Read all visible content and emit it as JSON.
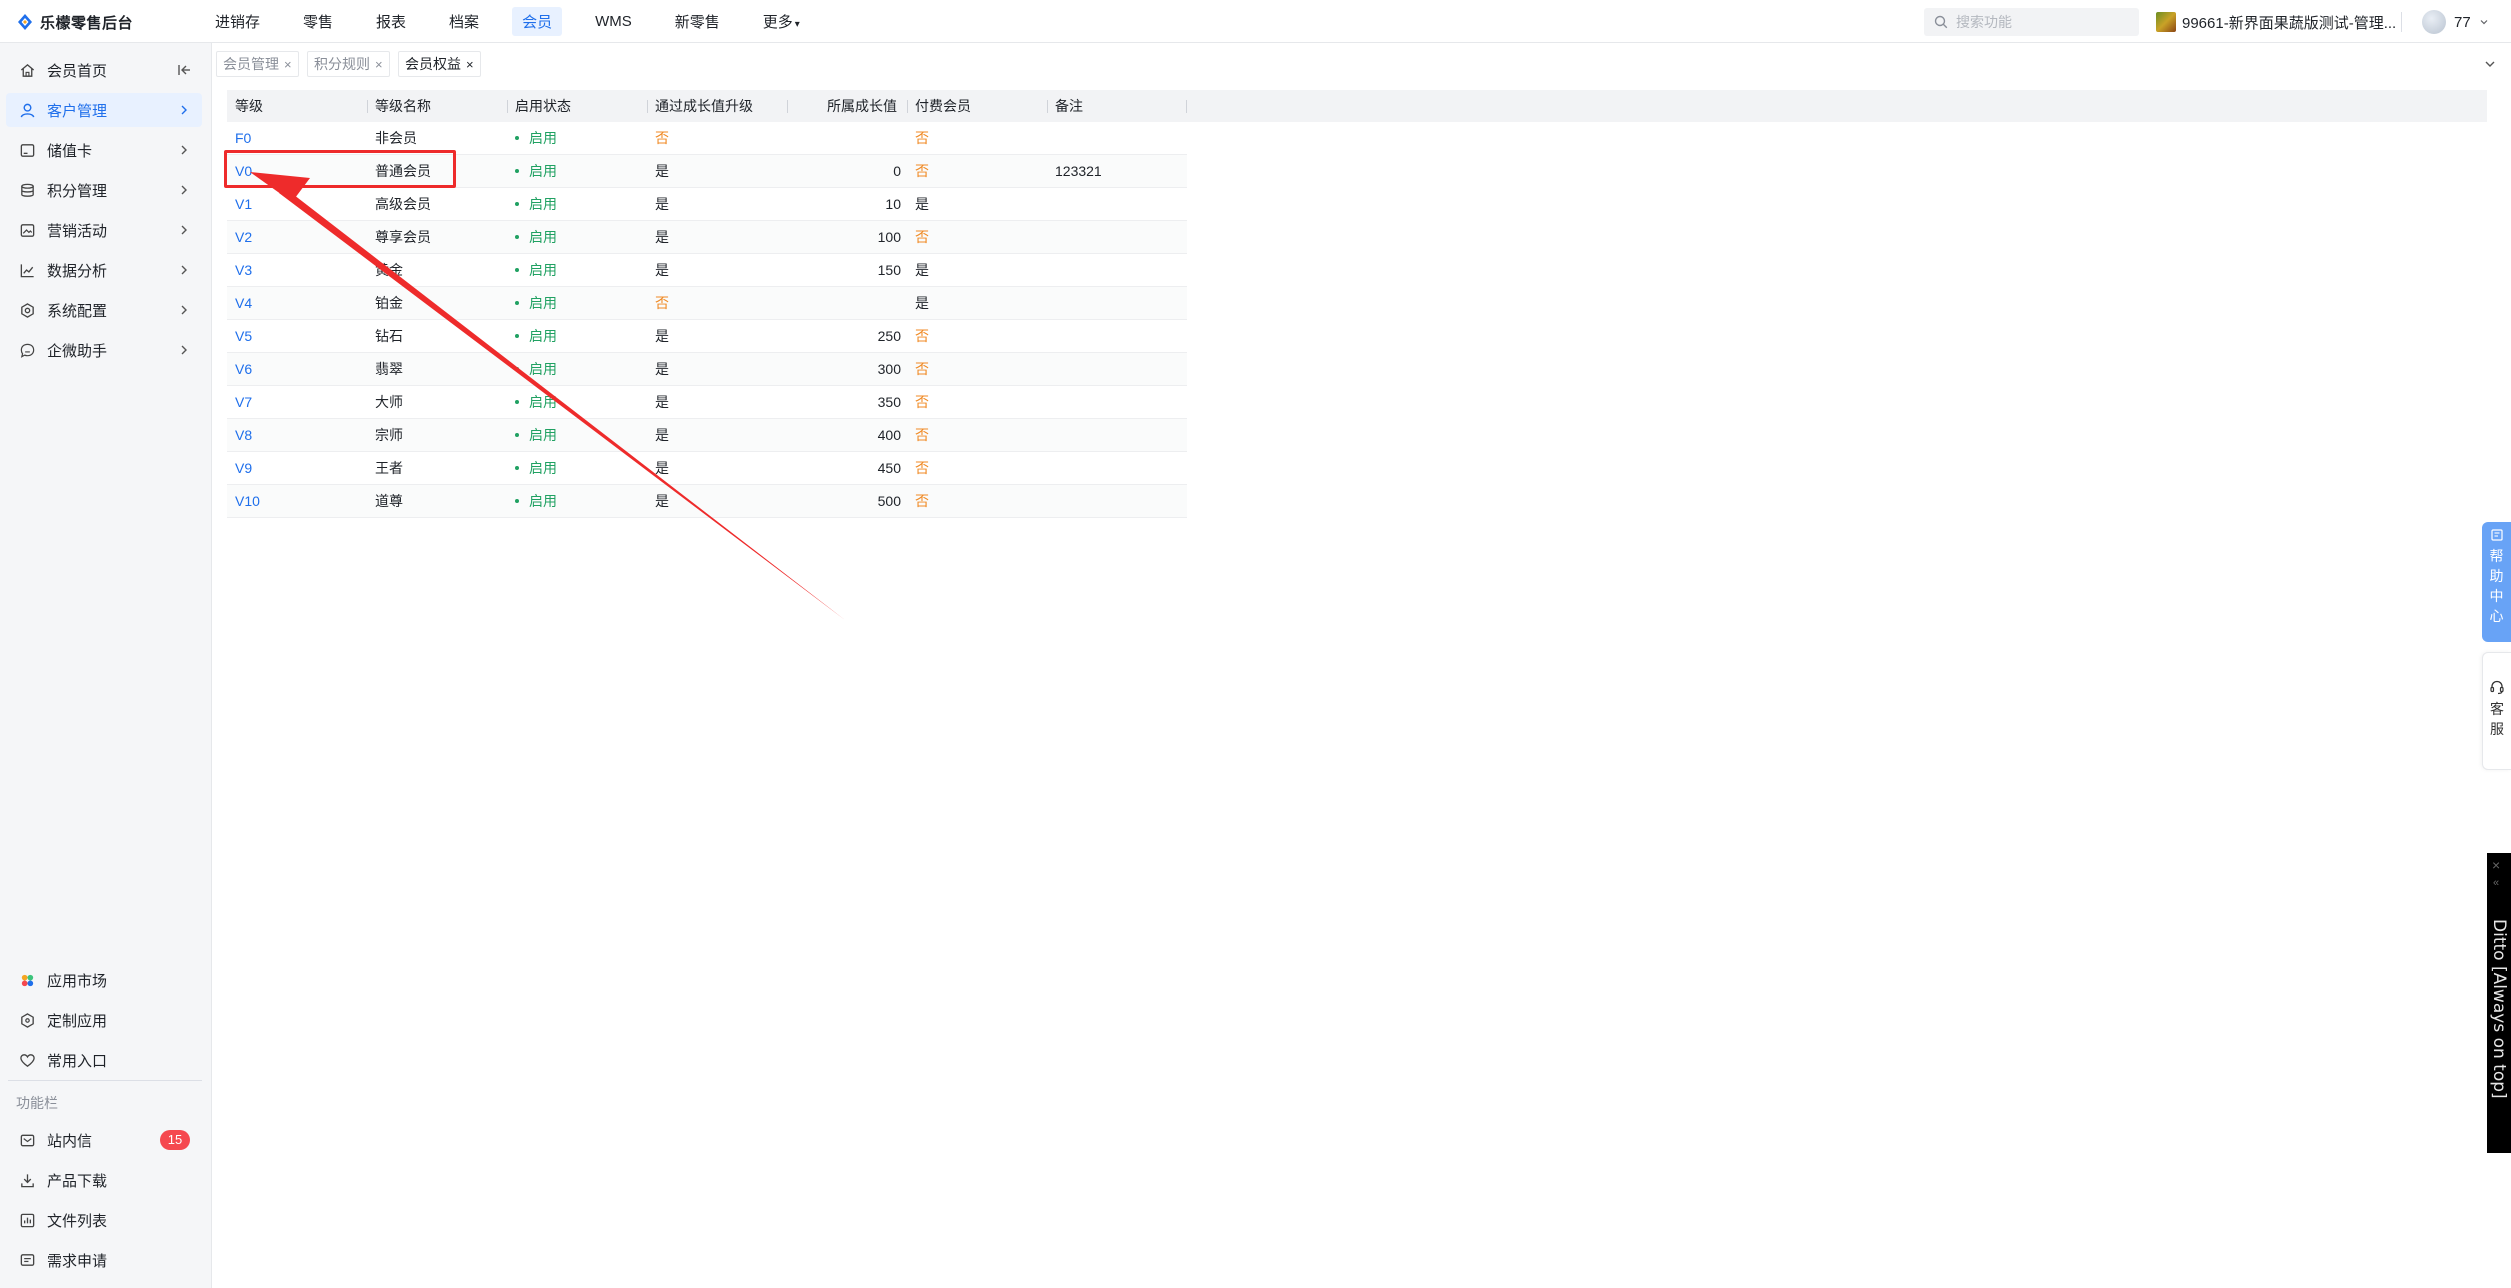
{
  "app": {
    "title": "乐檬零售后台",
    "brand_color": "#1f6feb"
  },
  "topnav": {
    "items": [
      {
        "label": "进销存"
      },
      {
        "label": "零售"
      },
      {
        "label": "报表"
      },
      {
        "label": "档案"
      },
      {
        "label": "会员"
      },
      {
        "label": "WMS"
      },
      {
        "label": "新零售"
      },
      {
        "label": "更多"
      }
    ],
    "active_index": 4
  },
  "search": {
    "placeholder": "搜索功能",
    "value": ""
  },
  "store": {
    "name": "99661-新界面果蔬版测试-管理..."
  },
  "user": {
    "name": "77"
  },
  "sidebar": {
    "items": [
      {
        "label": "会员首页",
        "icon": "home-icon"
      },
      {
        "label": "客户管理",
        "icon": "user-icon"
      },
      {
        "label": "储值卡",
        "icon": "card-icon"
      },
      {
        "label": "积分管理",
        "icon": "database-icon"
      },
      {
        "label": "营销活动",
        "icon": "image-icon"
      },
      {
        "label": "数据分析",
        "icon": "chart-line-icon"
      },
      {
        "label": "系统配置",
        "icon": "settings-icon"
      },
      {
        "label": "企微助手",
        "icon": "chat-icon"
      }
    ],
    "active_index": 1,
    "bottom_items": [
      {
        "label": "应用市场",
        "icon": "app-market-icon"
      },
      {
        "label": "定制应用",
        "icon": "custom-app-icon"
      },
      {
        "label": "常用入口",
        "icon": "heart-icon"
      }
    ],
    "section_title": "功能栏",
    "function_items": [
      {
        "label": "站内信",
        "icon": "mail-icon",
        "badge": "15"
      },
      {
        "label": "产品下载",
        "icon": "download-icon"
      },
      {
        "label": "文件列表",
        "icon": "file-list-icon"
      },
      {
        "label": "需求申请",
        "icon": "request-icon"
      }
    ]
  },
  "tabs": [
    {
      "label": "会员管理",
      "close": "×"
    },
    {
      "label": "积分规则",
      "close": "×"
    },
    {
      "label": "会员权益",
      "close": "×"
    }
  ],
  "active_tab": 2,
  "table": {
    "columns": [
      "等级",
      "等级名称",
      "启用状态",
      "通过成长值升级",
      "所属成长值",
      "付费会员",
      "备注"
    ],
    "rows": [
      {
        "level": "F0",
        "name": "非会员",
        "status": "启用",
        "upgrade": "否",
        "growth": "",
        "paid": "否",
        "note": ""
      },
      {
        "level": "V0",
        "name": "普通会员",
        "status": "启用",
        "upgrade": "是",
        "growth": "0",
        "paid": "否",
        "note": "123321"
      },
      {
        "level": "V1",
        "name": "高级会员",
        "status": "启用",
        "upgrade": "是",
        "growth": "10",
        "paid": "是",
        "note": ""
      },
      {
        "level": "V2",
        "name": "尊享会员",
        "status": "启用",
        "upgrade": "是",
        "growth": "100",
        "paid": "否",
        "note": ""
      },
      {
        "level": "V3",
        "name": "黄金",
        "status": "启用",
        "upgrade": "是",
        "growth": "150",
        "paid": "是",
        "note": ""
      },
      {
        "level": "V4",
        "name": "铂金",
        "status": "启用",
        "upgrade": "否",
        "growth": "",
        "paid": "是",
        "note": ""
      },
      {
        "level": "V5",
        "name": "钻石",
        "status": "启用",
        "upgrade": "是",
        "growth": "250",
        "paid": "否",
        "note": ""
      },
      {
        "level": "V6",
        "name": "翡翠",
        "status": "启用",
        "upgrade": "是",
        "growth": "300",
        "paid": "否",
        "note": ""
      },
      {
        "level": "V7",
        "name": "大师",
        "status": "启用",
        "upgrade": "是",
        "growth": "350",
        "paid": "否",
        "note": ""
      },
      {
        "level": "V8",
        "name": "宗师",
        "status": "启用",
        "upgrade": "是",
        "growth": "400",
        "paid": "否",
        "note": ""
      },
      {
        "level": "V9",
        "name": "王者",
        "status": "启用",
        "upgrade": "是",
        "growth": "450",
        "paid": "否",
        "note": ""
      },
      {
        "level": "V10",
        "name": "道尊",
        "status": "启用",
        "upgrade": "是",
        "growth": "500",
        "paid": "否",
        "note": ""
      }
    ],
    "highlighted_row": 1
  },
  "floating": {
    "help_center_chars": [
      "帮",
      "助",
      "中",
      "心"
    ],
    "customer_service_chars": [
      "客",
      "服"
    ],
    "ditto_close": "×",
    "ditto_pin": "«",
    "ditto_label": "Ditto [Always on top]"
  },
  "colors": {
    "accent": "#1f6feb",
    "enabled_green": "#20a162",
    "no_orange": "#f08a24",
    "annotation_red": "#ee2b2b",
    "badge_red": "#f5484f"
  }
}
